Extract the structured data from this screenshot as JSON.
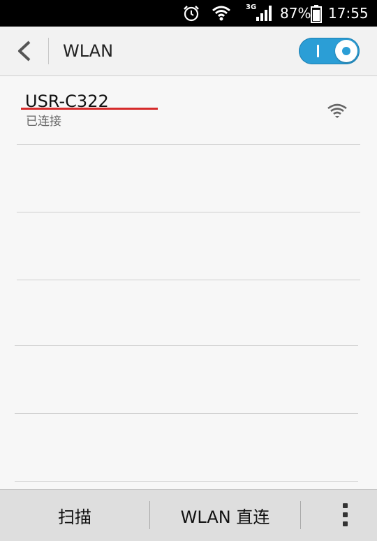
{
  "status_bar": {
    "network_type": "3G",
    "battery_level": "87%",
    "time": "17:55",
    "icons": [
      "alarm-icon",
      "wifi-icon",
      "signal-icon",
      "battery-icon"
    ]
  },
  "header": {
    "title": "WLAN",
    "wlan_enabled": true,
    "toggle_on_symbol": "I"
  },
  "networks": [
    {
      "ssid": "USR-C322",
      "status": "已连接",
      "icon": "wifi-signal-icon"
    }
  ],
  "bottom_bar": {
    "scan_label": "扫描",
    "direct_label": "WLAN 直连",
    "more_icon": "overflow-menu-icon"
  },
  "colors": {
    "accent": "#2b9ed6",
    "underline": "#d62b2b"
  }
}
